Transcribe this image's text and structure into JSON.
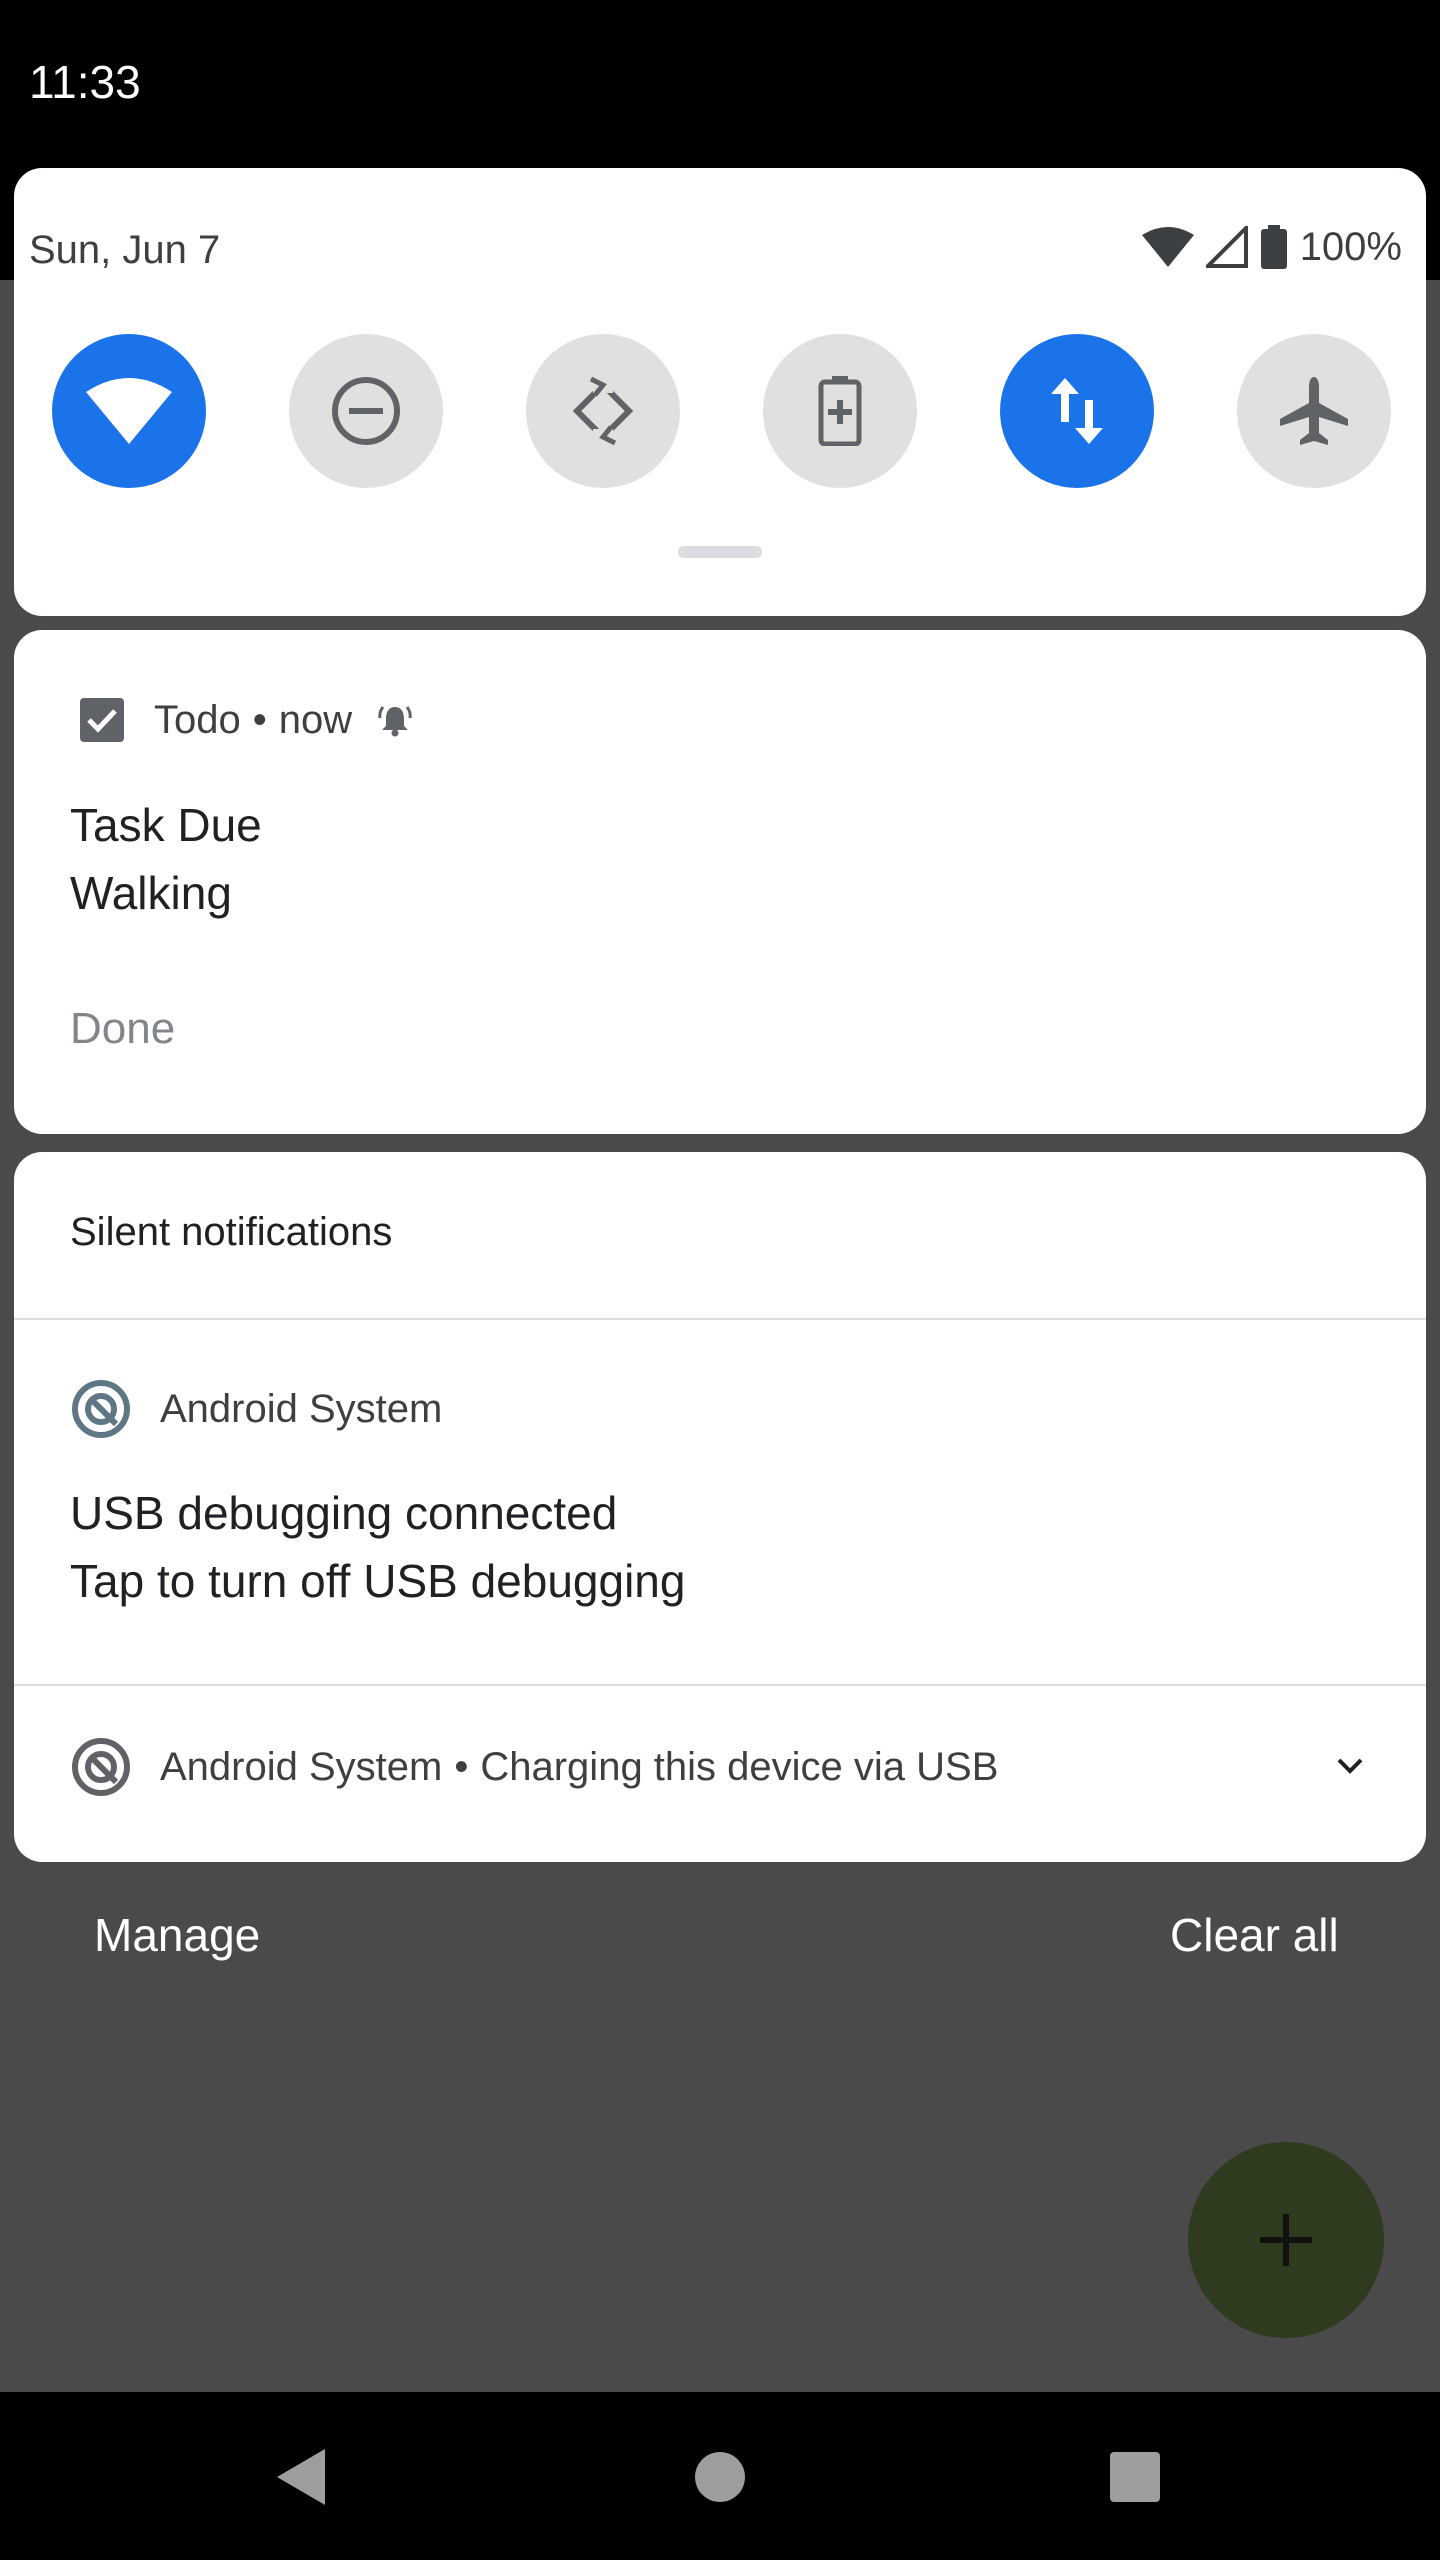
{
  "status_bar": {
    "time": "11:33"
  },
  "quick_settings": {
    "date": "Sun, Jun 7",
    "battery_percent": "100%",
    "tiles": [
      {
        "icon": "wifi-icon",
        "state": "on"
      },
      {
        "icon": "do-not-disturb-icon",
        "state": "off"
      },
      {
        "icon": "auto-rotate-icon",
        "state": "off"
      },
      {
        "icon": "battery-saver-icon",
        "state": "off"
      },
      {
        "icon": "mobile-data-icon",
        "state": "on"
      },
      {
        "icon": "airplane-mode-icon",
        "state": "off"
      }
    ]
  },
  "todo_notification": {
    "app_name": "Todo",
    "time": "now",
    "title": "Task Due",
    "text": "Walking",
    "action": "Done"
  },
  "silent_notifications": {
    "header": "Silent notifications",
    "usb_debugging": {
      "app_name": "Android System",
      "title": "USB debugging connected",
      "text": "Tap to turn off USB debugging"
    },
    "charging": {
      "app_name": "Android System",
      "text": "Charging this device via USB"
    }
  },
  "footer": {
    "manage": "Manage",
    "clear_all": "Clear all"
  },
  "colors": {
    "accent": "#1a73e8",
    "scrim": "#4a4a4a",
    "fab": "#2f3b1e"
  }
}
